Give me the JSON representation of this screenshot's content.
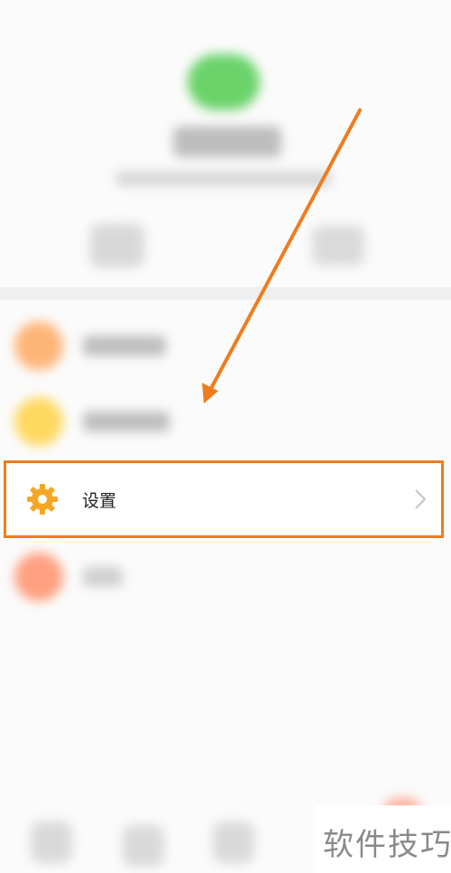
{
  "settings_row": {
    "label": "设置",
    "icon": "gear-icon",
    "chevron": "chevron-right-icon"
  },
  "annotation": {
    "arrow_color": "#f07c1c",
    "highlight_color": "#f07c1c"
  },
  "colors": {
    "gear": "#f5a623",
    "avatar": "#6ad36a",
    "menu_1": "#ffb477",
    "menu_2": "#ffd860",
    "menu_4": "#ffa080"
  },
  "watermark": {
    "text": "软件技巧"
  }
}
